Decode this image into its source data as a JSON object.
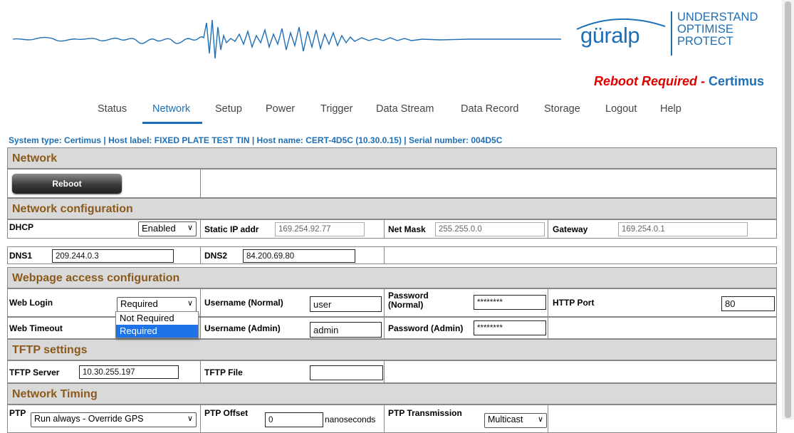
{
  "brand": {
    "logo": "güralp",
    "tagline": [
      "UNDERSTAND",
      "OPTIMISE",
      "PROTECT"
    ],
    "color": "#1e6fb5"
  },
  "reboot_notice": {
    "prefix": "Reboot Required",
    "dash": " - ",
    "device": "Certimus"
  },
  "nav": {
    "items": [
      "Status",
      "Network",
      "Setup",
      "Power",
      "Trigger",
      "Data Stream",
      "Data Record",
      "Storage",
      "Logout",
      "Help"
    ],
    "active": "Network"
  },
  "system_info": "System type: Certimus | Host label: FIXED PLATE TEST TIN | Host name: CERT-4D5C (10.30.0.15) | Serial number: 004D5C",
  "sections": {
    "network": "Network",
    "network_config": "Network configuration",
    "webpage": "Webpage access configuration",
    "tftp": "TFTP settings",
    "timing": "Network Timing"
  },
  "reboot_button": "Reboot",
  "network_config": {
    "dhcp_label": "DHCP",
    "dhcp_value": "Enabled",
    "static_ip_label": "Static IP addr",
    "static_ip": "169.254.92.77",
    "netmask_label": "Net Mask",
    "netmask": "255.255.0.0",
    "gateway_label": "Gateway",
    "gateway": "169.254.0.1",
    "dns1_label": "DNS1",
    "dns1": "209.244.0.3",
    "dns2_label": "DNS2",
    "dns2": "84.200.69.80"
  },
  "web_access": {
    "login_label": "Web Login",
    "login_value": "Required",
    "login_options": [
      "Not Required",
      "Required"
    ],
    "user_normal_label": "Username (Normal)",
    "user_normal": "user",
    "pass_normal_label": "Password (Normal)",
    "pass_normal": "********",
    "http_port_label": "HTTP Port",
    "http_port": "80",
    "timeout_label": "Web Timeout",
    "user_admin_label": "Username (Admin)",
    "user_admin": "admin",
    "pass_admin_label": "Password (Admin)",
    "pass_admin": "********"
  },
  "tftp": {
    "server_label": "TFTP Server",
    "server": "10.30.255.197",
    "file_label": "TFTP File",
    "file": ""
  },
  "timing": {
    "ptp_label": "PTP",
    "ptp_value": "Run always - Override GPS",
    "offset_label": "PTP Offset",
    "offset": "0",
    "offset_unit": "nanoseconds",
    "transmission_label": "PTP Transmission",
    "transmission_value": "Multicast"
  }
}
